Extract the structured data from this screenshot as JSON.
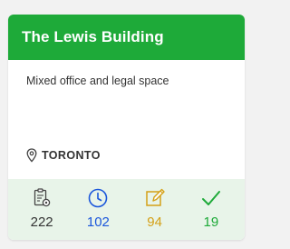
{
  "card": {
    "title": "The Lewis Building",
    "description": "Mixed office and legal space",
    "location": "TORONTO",
    "header_color": "#1eaa39"
  },
  "stats": [
    {
      "icon": "clipboard-gear-icon",
      "value": "222",
      "color": "#333333"
    },
    {
      "icon": "clock-icon",
      "value": "102",
      "color": "#1a56db"
    },
    {
      "icon": "edit-icon",
      "value": "94",
      "color": "#d4a017"
    },
    {
      "icon": "checkmark-icon",
      "value": "19",
      "color": "#1eaa39"
    }
  ]
}
